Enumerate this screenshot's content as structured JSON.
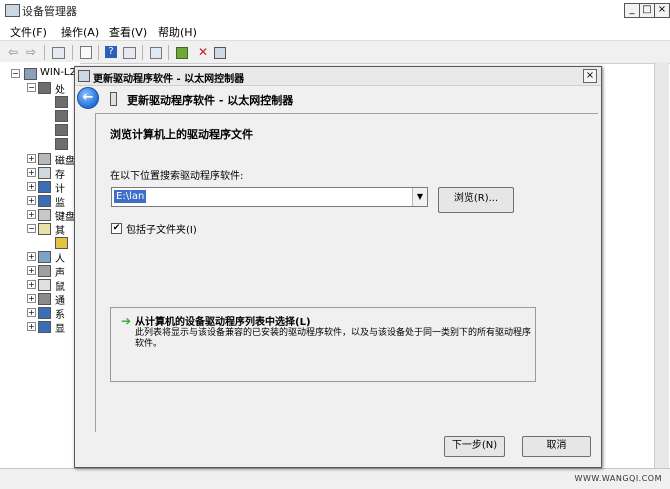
{
  "window": {
    "title": "设备管理器",
    "controls": {
      "minimize": "_",
      "maximize": "□",
      "close": "×"
    }
  },
  "menu": {
    "file": "文件(F)",
    "action": "操作(A)",
    "view": "查看(V)",
    "help": "帮助(H)"
  },
  "toolbar": {
    "back": "⇦",
    "forward": "⇨"
  },
  "tree": {
    "root": "WIN-L2",
    "items": [
      "处",
      "磁盘",
      "存",
      "计",
      "监",
      "键盘",
      "其",
      "人",
      "声",
      "鼠",
      "通",
      "系",
      "显"
    ]
  },
  "dialog": {
    "title": "更新驱动程序软件 - 以太网控制器",
    "header": "更新驱动程序软件 - 以太网控制器",
    "heading": "浏览计算机上的驱动程序文件",
    "search_label": "在以下位置搜索驱动程序软件:",
    "path_value": "E:\\lan",
    "browse_label": "浏览(R)...",
    "include_subfolders_label": "包括子文件夹(I)",
    "include_subfolders_checked": "✔",
    "pick_title": "从计算机的设备驱动程序列表中选择(L)",
    "pick_desc": "此列表将显示与该设备兼容的已安装的驱动程序软件，以及与该设备处于同一类别下的所有驱动程序软件。",
    "next_label": "下一步(N)",
    "cancel_label": "取消",
    "close": "×",
    "back_glyph": "←"
  },
  "watermark": "WWW.WANGQI.COM"
}
